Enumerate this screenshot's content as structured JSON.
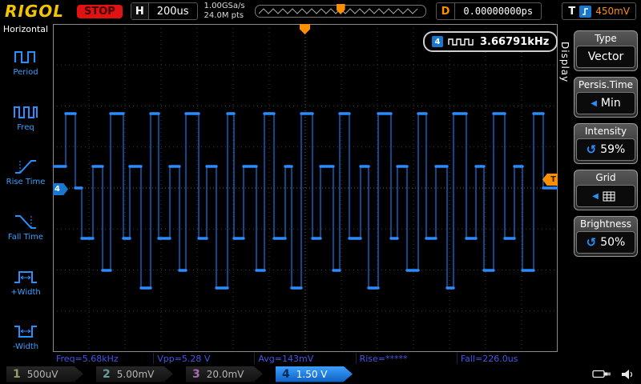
{
  "header": {
    "logo": "RIGOL",
    "run_state": "STOP",
    "horizontal_label": "H",
    "timebase": "200us",
    "sample_rate": "1.00GSa/s",
    "memory_depth": "24.0M pts",
    "delay_label": "D",
    "delay_value": "0.00000000ps",
    "trigger_label": "T",
    "trigger_level": "450mV"
  },
  "left_menu": {
    "title": "Horizontal",
    "items": [
      {
        "label": "Period"
      },
      {
        "label": "Freq"
      },
      {
        "label": "Rise Time"
      },
      {
        "label": "Fall Time"
      },
      {
        "label": "+Width"
      },
      {
        "label": "-Width"
      }
    ]
  },
  "freq_counter": {
    "channel": "4",
    "value": "3.66791kHz"
  },
  "measurements": [
    "Freq=5.68kHz",
    "Vpp=5.28 V",
    "Avg=143mV",
    "Rise=*****",
    "Fall=226.0us"
  ],
  "channels": [
    {
      "num": "1",
      "scale": "500uV",
      "active": false,
      "color": "#9a9a6a"
    },
    {
      "num": "2",
      "scale": "5.00mV",
      "active": false,
      "color": "#6a9a9a"
    },
    {
      "num": "3",
      "scale": "20.0mV",
      "active": false,
      "color": "#a86ab0"
    },
    {
      "num": "4",
      "scale": "1.50 V",
      "active": true,
      "color": "#1f7fde"
    }
  ],
  "right_menu": {
    "tab": "Display",
    "items": [
      {
        "label": "Type",
        "value": "Vector"
      },
      {
        "label": "Persis.Time",
        "value": "Min"
      },
      {
        "label": "Intensity",
        "value": "59%"
      },
      {
        "label": "Grid",
        "value": ""
      },
      {
        "label": "Brightness",
        "value": "50%"
      }
    ]
  },
  "graticule": {
    "cols": 14,
    "rows": 8
  },
  "waveform": {
    "color": "#2b8cff",
    "vertical_color": "#1565c4",
    "steps": [
      [
        16,
        178
      ],
      [
        12,
        112
      ],
      [
        8,
        205
      ],
      [
        14,
        268
      ],
      [
        12,
        178
      ],
      [
        10,
        308
      ],
      [
        16,
        112
      ],
      [
        8,
        268
      ],
      [
        14,
        178
      ],
      [
        12,
        330
      ],
      [
        10,
        112
      ],
      [
        14,
        268
      ],
      [
        12,
        178
      ],
      [
        8,
        308
      ],
      [
        16,
        112
      ],
      [
        10,
        268
      ],
      [
        12,
        178
      ],
      [
        14,
        330
      ],
      [
        8,
        112
      ],
      [
        12,
        268
      ],
      [
        16,
        178
      ],
      [
        10,
        308
      ],
      [
        12,
        112
      ],
      [
        14,
        268
      ],
      [
        8,
        178
      ],
      [
        12,
        330
      ],
      [
        14,
        112
      ],
      [
        10,
        268
      ],
      [
        16,
        178
      ],
      [
        8,
        308
      ],
      [
        12,
        112
      ],
      [
        14,
        268
      ],
      [
        10,
        178
      ],
      [
        12,
        330
      ],
      [
        16,
        112
      ],
      [
        8,
        268
      ],
      [
        12,
        178
      ],
      [
        14,
        308
      ],
      [
        10,
        112
      ],
      [
        12,
        268
      ],
      [
        14,
        178
      ],
      [
        8,
        330
      ],
      [
        16,
        112
      ],
      [
        12,
        268
      ],
      [
        10,
        178
      ],
      [
        12,
        308
      ],
      [
        14,
        112
      ],
      [
        12,
        268
      ],
      [
        10,
        178
      ],
      [
        14,
        308
      ],
      [
        12,
        112
      ],
      [
        18,
        205
      ]
    ]
  }
}
